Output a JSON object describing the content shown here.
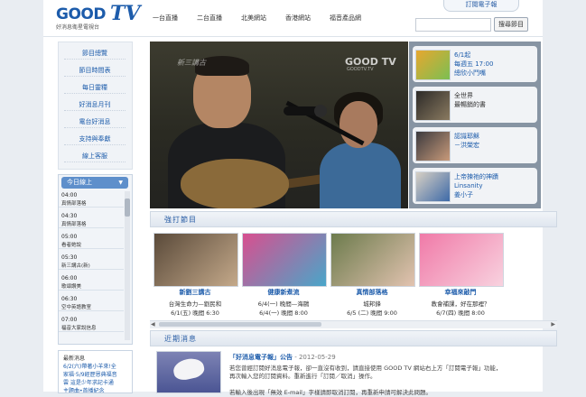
{
  "header": {
    "logo_text": "GOOD",
    "logo_tv": "TV",
    "logo_sub": "好消息衛星電視台",
    "nav": [
      {
        "label": "一台直播"
      },
      {
        "label": "二台直播"
      },
      {
        "label": "北美網站"
      },
      {
        "label": "香港網站"
      },
      {
        "label": "福音產品網"
      }
    ],
    "subscribe_label": "訂閱電子報",
    "search_placeholder": "",
    "search_button": "搜尋節目"
  },
  "sidebar": {
    "menu": [
      {
        "label": "節目總覽"
      },
      {
        "label": "節目時間表"
      },
      {
        "label": "每日靈糧"
      },
      {
        "label": "好消息月刊"
      },
      {
        "label": "電台好消息"
      },
      {
        "label": "支持與奉獻"
      },
      {
        "label": "線上客服"
      }
    ],
    "schedule": {
      "header": "今日線上",
      "caret": "▼",
      "items": [
        {
          "time": "04:00",
          "title": "真情部落格"
        },
        {
          "time": "04:30",
          "title": "真情部落格"
        },
        {
          "time": "05:00",
          "title": "看者她說"
        },
        {
          "time": "05:30",
          "title": "新三講古(新)"
        },
        {
          "time": "06:00",
          "title": "歌頌讚美"
        },
        {
          "time": "06:30",
          "title": "空中英語教室"
        },
        {
          "time": "07:00",
          "title": "福音大家說信息"
        }
      ]
    },
    "news": {
      "title": "最新消息",
      "body": "6/2(六)帶著小羊來!全\n家福·5/9經歷恩典福音\n雲 這是少年求記卡通\n主題曲•首播紀念"
    }
  },
  "video": {
    "channel_mark": "新三講古",
    "watermark": "GOOD TV",
    "watermark_sub": "GOODTV.TV"
  },
  "features": [
    {
      "text": "6/1起\n每週五 17:00\n總欣小鬥嘴",
      "dark": false
    },
    {
      "text": "全世界\n最暢銷的書",
      "dark": true
    },
    {
      "text": "認識耶穌\n－洪榮宏",
      "dark": false
    },
    {
      "text": "上帝揀祂的神蹟\nLinsanity\n姜小子",
      "dark": false
    }
  ],
  "recommended": {
    "title": "強打節目",
    "items": [
      {
        "name": "新劉三講古",
        "info": "台灣生命力—劉民和",
        "time": "6/1(五) 晚間 6:30"
      },
      {
        "name": "健康新煮流",
        "info": "6/4(一) 晚間—海鷗",
        "time": "6/4(一) 晚間 8:00"
      },
      {
        "name": "真情部落格",
        "info": "城邦鋒",
        "time": "6/5 (二) 晚間 9:00"
      },
      {
        "name": "幸福來敲門",
        "info": "教會補課，好在那裡？",
        "time": "6/7(四) 晚間 8:00"
      }
    ],
    "scroll_left": "◀",
    "scroll_right": "▶"
  },
  "latest": {
    "title": "近期消息",
    "headline": "「好消息電子報」公告",
    "date": " - 2012-05-29",
    "body": "若您曾經訂閱好消息電子報，卻一直沒有收到，請直接使用 GOOD TV 網站右上方「訂閱電子報」功能，\n再次輸入您的訂閱資料。重新進行「訂閱／取消」操作。\n\n若輸入後出現「無效 E-mail」字樣請即取消訂閱，再重新申請可解決此問題。"
  }
}
